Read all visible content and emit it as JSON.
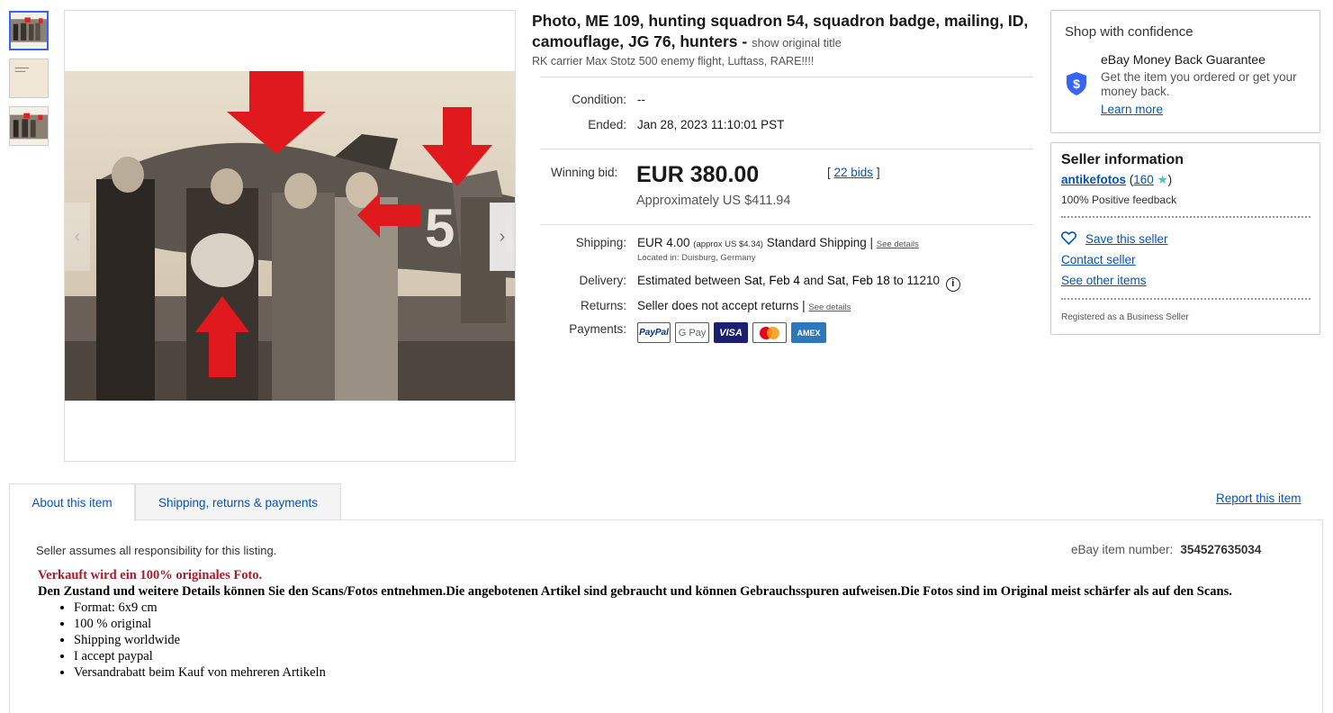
{
  "gallery": {
    "thumbnail_count": 3,
    "next_icon": "chevron-right-icon"
  },
  "title": {
    "main": "Photo, ME 109, hunting squadron 54, squadron badge, mailing, ID, camouflage, JG 76, hunters - ",
    "show_original": "show original title",
    "subtitle": "RK carrier Max Stotz 500 enemy flight, Luftass, RARE!!!!"
  },
  "details": {
    "condition_label": "Condition:",
    "condition_value": "--",
    "ended_label": "Ended:",
    "ended_value": "Jan 28, 2023 11:10:01 PST"
  },
  "bid": {
    "label": "Winning bid:",
    "price": "EUR 380.00",
    "approx": "Approximately US $411.94",
    "bids_open": "[ ",
    "bids_link": "22 bids",
    "bids_close": " ]"
  },
  "shipping": {
    "label": "Shipping:",
    "price": "EUR 4.00",
    "approx": "(approx US $4.34)",
    "method": "Standard Shipping | ",
    "see_details": "See details",
    "location": "Located in: Duisburg, Germany"
  },
  "delivery": {
    "label": "Delivery:",
    "prefix": "Estimated between ",
    "date1": "Sat, Feb 4",
    "middle": " and ",
    "date2": "Sat, Feb 18",
    "suffix": " to 11210"
  },
  "returns": {
    "label": "Returns:",
    "value": "Seller does not accept returns | ",
    "see_details": "See details"
  },
  "payments": {
    "label": "Payments:",
    "methods": [
      "PayPal",
      "G Pay",
      "VISA",
      "",
      "AMEX"
    ]
  },
  "confidence": {
    "title": "Shop with confidence",
    "heading": "eBay Money Back Guarantee",
    "text": "Get the item you ordered or get your money back.",
    "link": "Learn more"
  },
  "seller": {
    "title": "Seller information",
    "name": "antikefotos",
    "open_paren": " (",
    "feedback_count": "160",
    "close_paren": ")",
    "positive": "100% Positive feedback",
    "save": "Save this seller",
    "contact": "Contact seller",
    "other_items": "See other items",
    "registered": "Registered as a Business Seller"
  },
  "tabs": {
    "about": "About this item",
    "shipping": "Shipping, returns & payments",
    "report": "Report this item"
  },
  "description": {
    "responsibility": "Seller assumes all responsibility for this listing.",
    "item_number_label": "eBay item number:",
    "item_number": "354527635034",
    "headline": "Verkauft wird ein 100% originales Foto.",
    "body": "Den Zustand und weitere Details können Sie den Scans/Fotos entnehmen.Die angebotenen Artikel sind gebraucht und können Gebrauchsspuren aufweisen.Die Fotos sind im Original meist schärfer als auf den Scans.",
    "bullets": [
      "Format: 6x9 cm",
      " 100 % original",
      "Shipping worldwide",
      " I accept paypal",
      "Versandrabatt beim Kauf von mehreren Artikeln"
    ]
  }
}
